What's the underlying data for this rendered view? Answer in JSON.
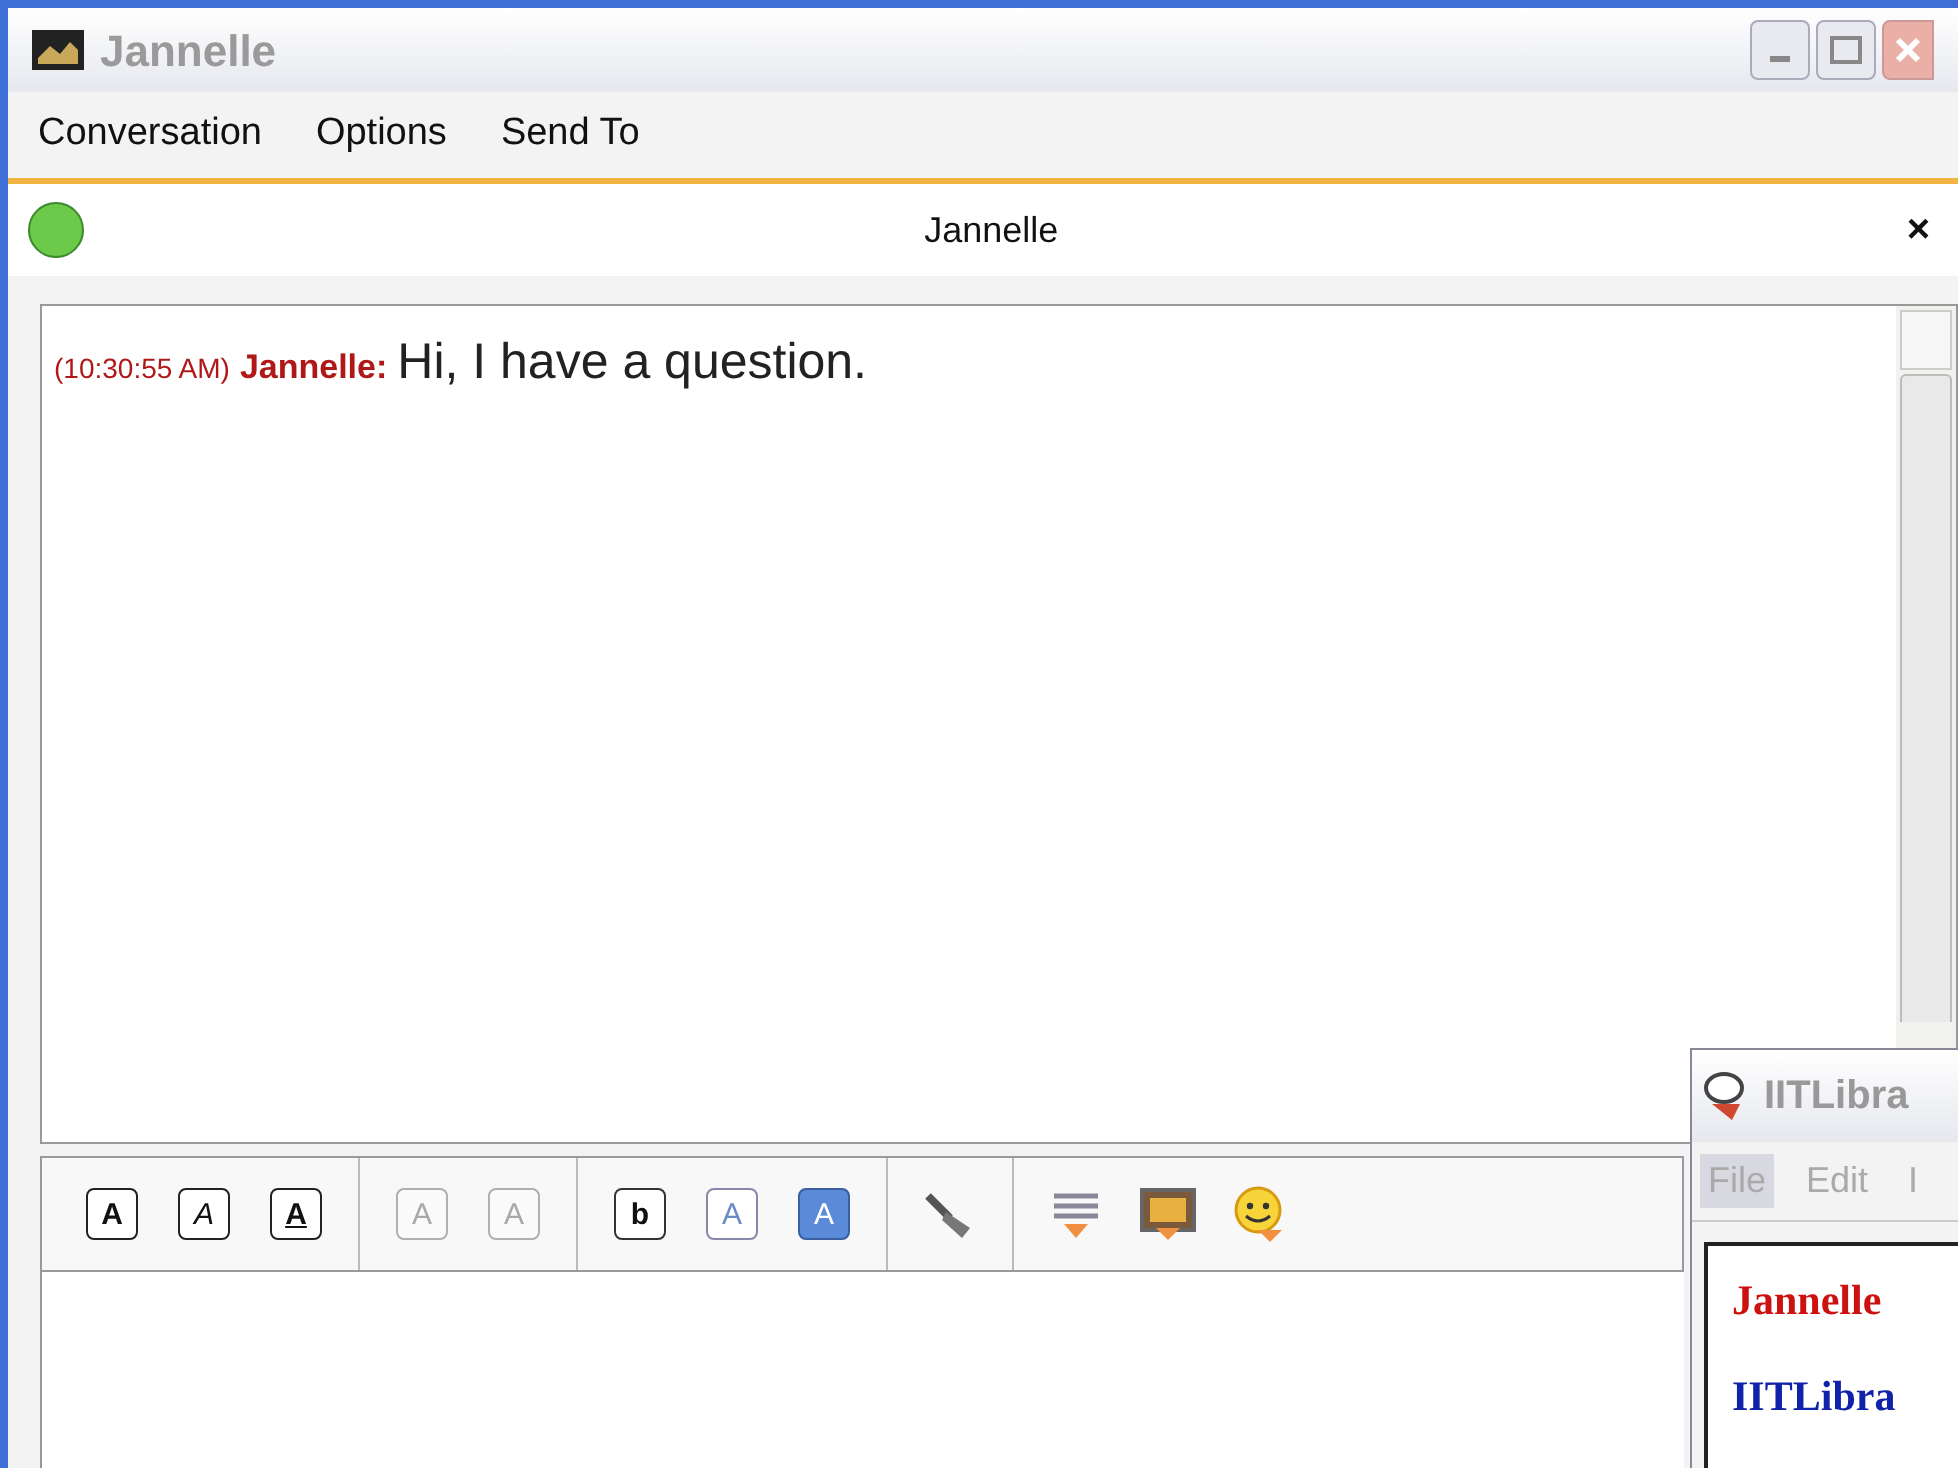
{
  "window": {
    "title": "Jannelle"
  },
  "menu": [
    "Conversation",
    "Options",
    "Send To"
  ],
  "conversation": {
    "contact": "Jannelle",
    "online": true,
    "close": "×"
  },
  "messages": [
    {
      "time": "(10:30:55 AM)",
      "sender": "Jannelle:",
      "text": "Hi, I have a question."
    }
  ],
  "toolbar": [
    {
      "kind": "bold",
      "label": "A",
      "disabled": false
    },
    {
      "kind": "italic",
      "label": "A",
      "disabled": false
    },
    {
      "kind": "underline",
      "label": "A",
      "disabled": false
    },
    {
      "kind": "sep"
    },
    {
      "kind": "grow",
      "label": "A",
      "disabled": true
    },
    {
      "kind": "shrink",
      "label": "A",
      "disabled": true
    },
    {
      "kind": "sep"
    },
    {
      "kind": "font",
      "label": "b",
      "disabled": false
    },
    {
      "kind": "fgcolor",
      "label": "A",
      "disabled": false
    },
    {
      "kind": "bgcolor",
      "label": "A",
      "disabled": false
    },
    {
      "kind": "sep"
    },
    {
      "kind": "brush",
      "disabled": false
    },
    {
      "kind": "sep"
    },
    {
      "kind": "link",
      "disabled": false
    },
    {
      "kind": "image",
      "disabled": false
    },
    {
      "kind": "smiley",
      "disabled": false
    }
  ],
  "other_window": {
    "title": "IITLibra",
    "menu": [
      {
        "label": "File",
        "selected": true
      },
      {
        "label": "Edit",
        "selected": false
      },
      {
        "label": "I",
        "selected": false
      }
    ],
    "lines": [
      {
        "text": "Jannelle",
        "color": "#cc1111"
      },
      {
        "text": "IITLibra",
        "color": "#1122aa"
      }
    ]
  }
}
